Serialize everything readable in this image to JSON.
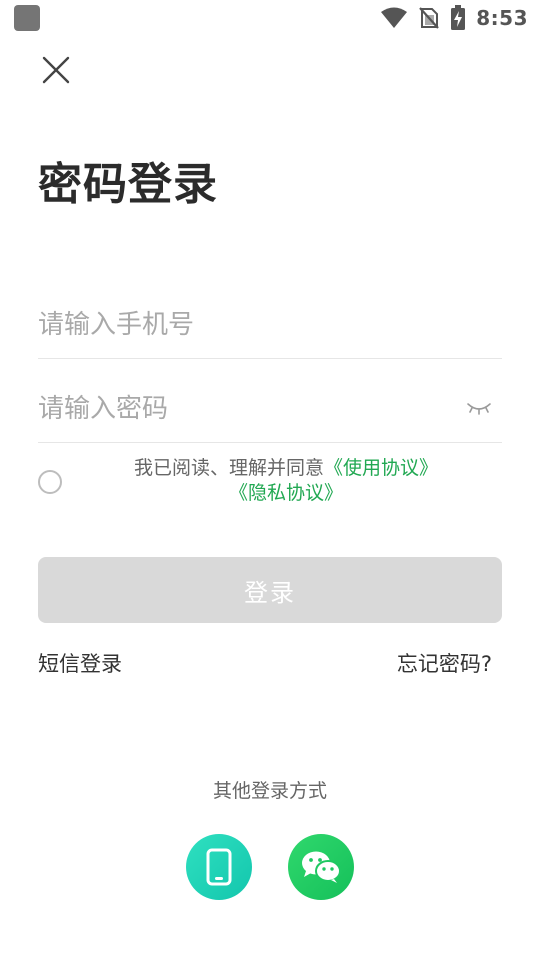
{
  "status_bar": {
    "time": "8:53",
    "icons": [
      "app-notification-icon",
      "wifi-icon",
      "no-sim-icon",
      "battery-charging-icon"
    ]
  },
  "header": {
    "close_icon": "close-icon",
    "title": "密码登录"
  },
  "form": {
    "phone_placeholder": "请输入手机号",
    "phone_value": "",
    "password_placeholder": "请输入密码",
    "password_value": "",
    "password_toggle_icon": "eye-closed-icon"
  },
  "agreement": {
    "prefix": "我已阅读、理解并同意",
    "terms_link": "《使用协议》",
    "privacy_link": "《隐私协议》",
    "checked": false,
    "link_color": "#21a852"
  },
  "actions": {
    "login_label": "登录",
    "login_disabled_color": "#d9d9d9",
    "sms_login_label": "短信登录",
    "forgot_password_label": "忘记密码?"
  },
  "other_login": {
    "label": "其他登录方式",
    "options": [
      {
        "icon": "mobile-phone-icon",
        "color": "#1ccdb3"
      },
      {
        "icon": "wechat-icon",
        "color": "#1fc862"
      }
    ]
  }
}
